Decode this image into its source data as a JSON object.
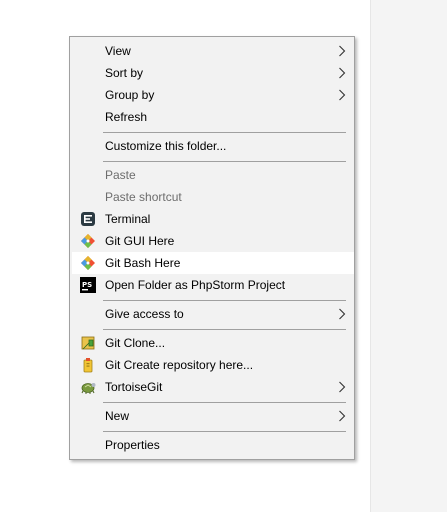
{
  "context_menu": {
    "view": "View",
    "sort_by": "Sort by",
    "group_by": "Group by",
    "refresh": "Refresh",
    "customize": "Customize this folder...",
    "paste": "Paste",
    "paste_shortcut": "Paste shortcut",
    "terminal": "Terminal",
    "git_gui": "Git GUI Here",
    "git_bash": "Git Bash Here",
    "phpstorm": "Open Folder as PhpStorm Project",
    "give_access": "Give access to",
    "git_clone": "Git Clone...",
    "git_create_repo": "Git Create repository here...",
    "tortoisegit": "TortoiseGit",
    "new": "New",
    "properties": "Properties"
  },
  "icons": {
    "terminal": "terminal-icon",
    "git_gui": "git-icon",
    "git_bash": "git-icon",
    "phpstorm": "phpstorm-icon",
    "git_clone": "tortoisegit-clone-icon",
    "git_create_repo": "tortoisegit-create-icon",
    "tortoisegit": "tortoisegit-icon",
    "submenu": "chevron-right-icon"
  },
  "colors": {
    "menu_background": "#f2f2f2",
    "menu_border": "#a0a0a0",
    "highlight": "#ffffff",
    "disabled_text": "#6d6d6d",
    "git_orange": "#f05133"
  }
}
